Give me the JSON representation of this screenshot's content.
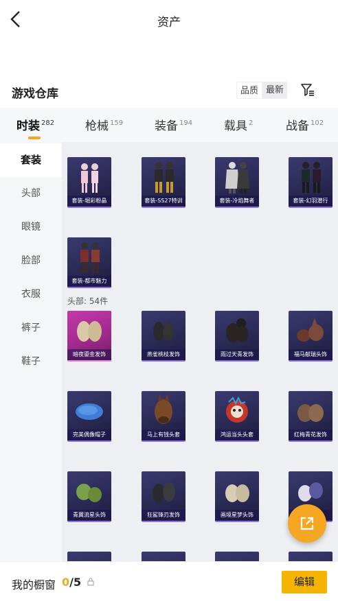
{
  "header": {
    "title": "资产"
  },
  "warehouse": {
    "title": "游戏仓库",
    "sort_quality": "品质",
    "sort_latest": "最新"
  },
  "tabs": [
    {
      "label": "时装",
      "count": "282"
    },
    {
      "label": "枪械",
      "count": "159"
    },
    {
      "label": "装备",
      "count": "194"
    },
    {
      "label": "载具",
      "count": "2"
    },
    {
      "label": "战备",
      "count": "102"
    }
  ],
  "sidebar": [
    "套装",
    "头部",
    "眼镜",
    "脸部",
    "衣服",
    "裤子",
    "鞋子"
  ],
  "sets": [
    "套装-堀彩粉晶",
    "套装-SS27特训",
    "套装-冷焰舞者",
    "套装-幻羽潜行",
    "套装-都市魅力"
  ],
  "head_section": "头部: 54件",
  "heads": [
    "暗夜鎏金发饰",
    "燕雀桃枝发饰",
    "雨过天青发饰",
    "福马献瑞头饰",
    "完美偶像帽子",
    "马上有钱头套",
    "鸿运当头头套",
    "红梅青花发饰",
    "青翼流星头饰",
    "狂鲨锋刃发饰",
    "画境星梦头饰",
    ""
  ],
  "bottom": {
    "showcase_label": "我的橱窗",
    "count_current": "0",
    "count_total": "/5",
    "edit": "编辑"
  },
  "colors": {
    "accent": "#f5a623",
    "edit_button": "#f5b400",
    "item_bg": "#2f2e5e",
    "item_highlight": "#c33aa8"
  }
}
